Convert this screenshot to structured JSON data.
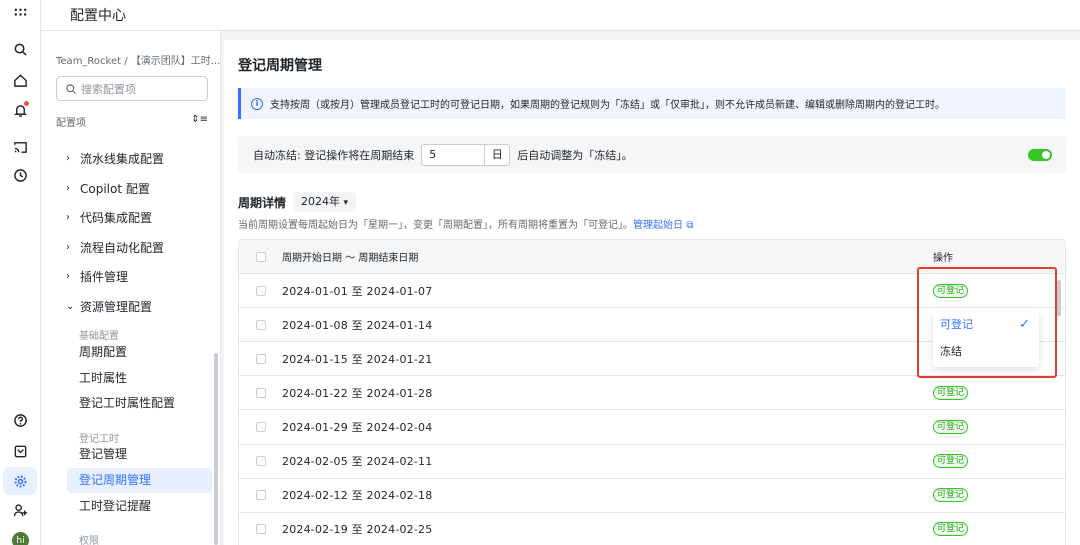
{
  "header": {
    "title": "配置中心"
  },
  "sidebar": {
    "breadcrumb": "Team_Rocket / 【演示团队】工时...",
    "search_placeholder": "搜索配置项",
    "section_label": "配置项",
    "menu": [
      {
        "label": "流水线集成配置"
      },
      {
        "label": "Copilot 配置"
      },
      {
        "label": "代码集成配置"
      },
      {
        "label": "流程自动化配置"
      },
      {
        "label": "插件管理"
      },
      {
        "label": "资源管理配置"
      }
    ],
    "groups": {
      "basic": "基础配置",
      "worklog": "登记工时",
      "permission": "权限"
    },
    "subitems": {
      "cycle_config": "周期配置",
      "hour_attr": "工时属性",
      "reg_attr": "登记工时属性配置",
      "reg_manage": "登记管理",
      "cycle_manage": "登记周期管理",
      "reminder": "工时登记提醒"
    }
  },
  "main": {
    "title": "登记周期管理",
    "notice": "支持按周（或按月）管理成员登记工时的可登记日期，如果周期的登记规则为「冻结」或「仅审批」，则不允许成员新建、编辑或删除周期内的登记工时。",
    "freeze": {
      "prefix": "自动冻结: 登记操作将在周期结束",
      "value": "5",
      "unit": "日",
      "suffix": "后自动调整为「冻结」。",
      "enabled": true
    },
    "period_title": "周期详情",
    "year": "2024年",
    "hint": "当前周期设置每周起始日为「星期一」，变更「周期配置」，所有周期将重置为「可登记」。",
    "hint_link": "管理起始日",
    "table": {
      "col_date": "周期开始日期 ～ 周期结束日期",
      "col_op": "操作",
      "rows": [
        {
          "range": "2024-01-01 至 2024-01-07",
          "status": "可登记"
        },
        {
          "range": "2024-01-08 至 2024-01-14",
          "status": ""
        },
        {
          "range": "2024-01-15 至 2024-01-21",
          "status": ""
        },
        {
          "range": "2024-01-22 至 2024-01-28",
          "status": "可登记"
        },
        {
          "range": "2024-01-29 至 2024-02-04",
          "status": "可登记"
        },
        {
          "range": "2024-02-05 至 2024-02-11",
          "status": "可登记"
        },
        {
          "range": "2024-02-12 至 2024-02-18",
          "status": "可登记"
        },
        {
          "range": "2024-02-19 至 2024-02-25",
          "status": "可登记"
        }
      ]
    },
    "dropdown": {
      "options": [
        "可登记",
        "冻结"
      ],
      "selected": "可登记"
    }
  },
  "user": {
    "avatar_text": "hi"
  },
  "colors": {
    "accent": "#3370ff",
    "success": "#34c724",
    "highlight": "#e53e30"
  }
}
